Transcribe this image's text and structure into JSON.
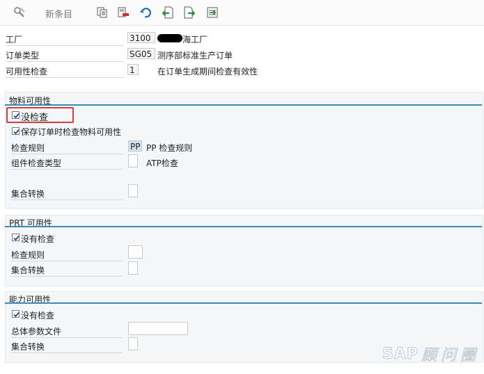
{
  "toolbar": {
    "new_entries_label": "新条目",
    "icons": [
      "display-change-icon",
      "copy-icon",
      "delete-icon",
      "undo-icon",
      "previous-entry-icon",
      "next-entry-icon",
      "other-entry-icon"
    ]
  },
  "header": {
    "plant_label": "工厂",
    "plant_value": "3100",
    "plant_desc_suffix": "海工厂",
    "order_type_label": "订单类型",
    "order_type_value": "SG05",
    "order_type_desc": "测序部标准生产订单",
    "availability_check_label": "可用性检查",
    "availability_check_value": "1",
    "availability_check_desc": "在订单生成期间检查有效性"
  },
  "material_availability": {
    "title": "物料可用性",
    "no_check_label": "没检查",
    "no_check_checked": true,
    "check_on_save_label": "保存订单时检查物料可用性",
    "check_on_save_checked": true,
    "checking_rule_label": "检查规则",
    "checking_rule_value": "PP",
    "checking_rule_desc": "PP 检查规则",
    "component_check_type_label": "组件检查类型",
    "component_check_type_desc": "ATP检查",
    "collective_conversion_label": "集合转换"
  },
  "prt_availability": {
    "title": "PRT 可用性",
    "no_check_label": "没有检查",
    "no_check_checked": true,
    "checking_rule_label": "检查规则",
    "collective_conversion_label": "集合转换"
  },
  "capacity_availability": {
    "title": "能力可用性",
    "no_check_label": "没有检查",
    "no_check_checked": true,
    "overall_profile_label": "总体参数文件",
    "collective_conversion_label": "集合转换"
  },
  "watermark": {
    "brand": "SAP",
    "text": "顾问圈"
  },
  "colors": {
    "accent": "#3a8ab4",
    "highlight": "#d43b3b"
  }
}
